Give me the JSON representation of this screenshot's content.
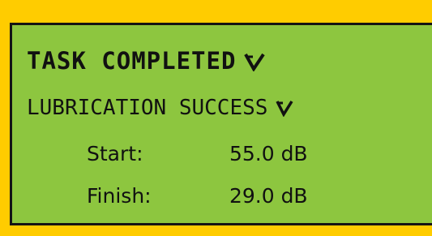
{
  "colors": {
    "frame": "#FFCC00",
    "screen": "#8DC63F",
    "text": "#111111"
  },
  "status": {
    "heading": "TASK COMPLETED",
    "heading_icon": "check-icon",
    "subheading": "LUBRICATION SUCCESS",
    "subheading_icon": "check-icon"
  },
  "readings": [
    {
      "label": "Start:",
      "value": "55.0 dB"
    },
    {
      "label": "Finish:",
      "value": "29.0 dB"
    }
  ]
}
